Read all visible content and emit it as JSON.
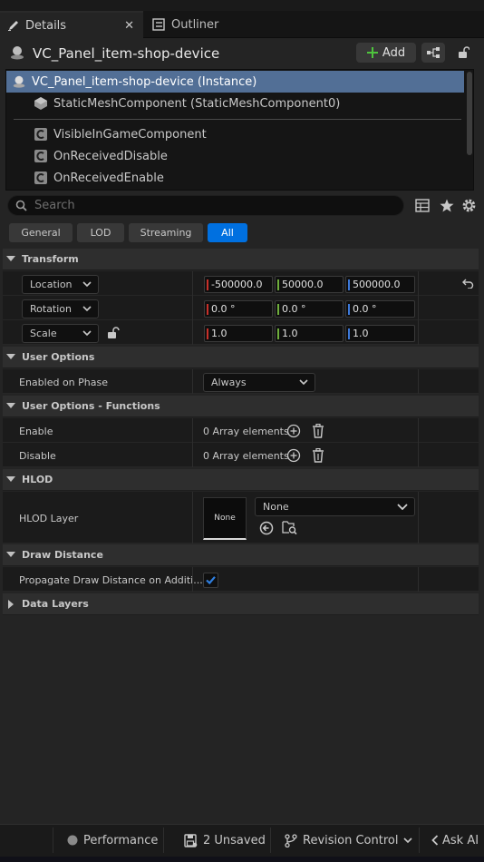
{
  "tabs": {
    "details": "Details",
    "outliner": "Outliner"
  },
  "header": {
    "actor_name": "VC_Panel_item-shop-device",
    "add_label": "Add"
  },
  "components": [
    {
      "label": "VC_Panel_item-shop-device (Instance)",
      "icon": "actor-icon",
      "selected": true
    },
    {
      "label": "StaticMeshComponent (StaticMeshComponent0)",
      "icon": "static-mesh-icon",
      "selected": false
    },
    {
      "label": "VisibleInGameComponent",
      "icon": "component-icon",
      "selected": false
    },
    {
      "label": "OnReceivedDisable",
      "icon": "component-icon",
      "selected": false
    },
    {
      "label": "OnReceivedEnable",
      "icon": "component-icon",
      "selected": false
    }
  ],
  "search": {
    "placeholder": "Search",
    "value": ""
  },
  "filters": [
    "General",
    "LOD",
    "Streaming",
    "All"
  ],
  "active_filter": "All",
  "sections": {
    "transform": {
      "title": "Transform",
      "location": {
        "label": "Location",
        "x": "-500000.0",
        "y": "50000.0",
        "z": "500000.0"
      },
      "rotation": {
        "label": "Rotation",
        "x": "0.0 °",
        "y": "0.0 °",
        "z": "0.0 °"
      },
      "scale": {
        "label": "Scale",
        "x": "1.0",
        "y": "1.0",
        "z": "1.0"
      }
    },
    "user_options": {
      "title": "User Options",
      "enabled_on_phase": {
        "label": "Enabled on Phase",
        "value": "Always"
      }
    },
    "user_options_functions": {
      "title": "User Options - Functions",
      "enable": {
        "label": "Enable",
        "value": "0 Array elements"
      },
      "disable": {
        "label": "Disable",
        "value": "0 Array elements"
      }
    },
    "hlod": {
      "title": "HLOD",
      "layer": {
        "label": "HLOD Layer",
        "thumbnail": "None",
        "value": "None"
      }
    },
    "draw_distance": {
      "title": "Draw Distance",
      "propagate": {
        "label": "Propagate Draw Distance on Additi...",
        "checked": true
      }
    },
    "data_layers": {
      "title": "Data Layers"
    }
  },
  "statusbar": {
    "performance": "Performance",
    "unsaved": "2 Unsaved",
    "revision_control": "Revision Control",
    "ask_ai": "Ask AI"
  },
  "colors": {
    "accent": "#0070e0",
    "selection": "#526f96",
    "axis_x": "#c8302a",
    "axis_y": "#6fae3c",
    "axis_z": "#3c78d8"
  }
}
